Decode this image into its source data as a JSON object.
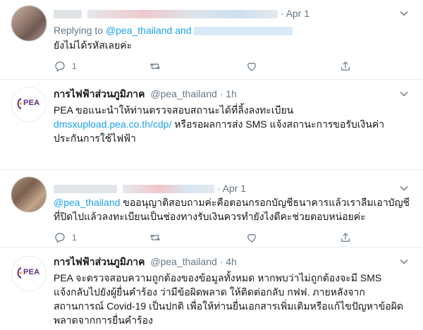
{
  "tweet1": {
    "date": "Apr 1",
    "replying_prefix": "Replying to",
    "replying_handle": "@pea_thailand",
    "replying_and": "and",
    "text": "ยังไม่ได้รหัสเลยค่ะ",
    "reply_count": "1"
  },
  "tweet2": {
    "name": "การไฟฟ้าส่วนภูมิภาค",
    "handle": "@pea_thailand",
    "time": "1h",
    "avatar_text": "PEA",
    "lines": [
      "PEA ขอแนะนำให้ท่านตรวจสอบสถานะได้ที่ลิ้งลงทะเบียน",
      "dmsxupload.pea.co.th/cdp/",
      "หรือรอผลการส่ง SMS แจ้งสถานะการขอรับเงินค่า",
      "ประกันการใช้ไฟฟ้า"
    ]
  },
  "tweet3": {
    "date": "Apr 1",
    "mention": "@pea_thailand",
    "line1_rest": " ขออนุญาติสอบถามค่ะคือตอนกรอกบัญชีธนาคารแล้วเราลืมเอาบัญชี",
    "line2": "ที่ปิดไปแล้วลงทะเบียนเป็นช่องทางรับเงินควรทำยังไงดีคะช่วยตอบหน่อยค่ะ",
    "reply_count": "1"
  },
  "tweet4": {
    "name": "การไฟฟ้าส่วนภูมิภาค",
    "handle": "@pea_thailand",
    "time": "4h",
    "avatar_text": "PEA",
    "lines": [
      "PEA จะตรวจสอบความถูกต้องของข้อมูลทั้งหมด หากพบว่าไม่ถูกต้องจะมี SMS",
      "แจ้งกลับไปยังผู้ยื่นคำร้อง ว่ามีข้อผิดพลาด ให้ติดต่อกลับ กฟฟ. ภายหลังจาก",
      "สถานการณ์ Covid-19 เป็นปกติ เพื่อให้ท่านยื่นเอกสารเพิ่มเติมหรือแก้ไขปัญหาข้อผิด",
      "พลาดจากการยื่นคำร้อง"
    ]
  },
  "colors": {
    "accent": "#1da1f2",
    "muted": "#657786",
    "divider": "#e6ecf0",
    "pea_purple": "#5a2a82",
    "pea_orange": "#f7941d"
  },
  "icons": [
    "reply-icon",
    "retweet-icon",
    "like-icon",
    "share-icon",
    "chevron-down-icon"
  ]
}
